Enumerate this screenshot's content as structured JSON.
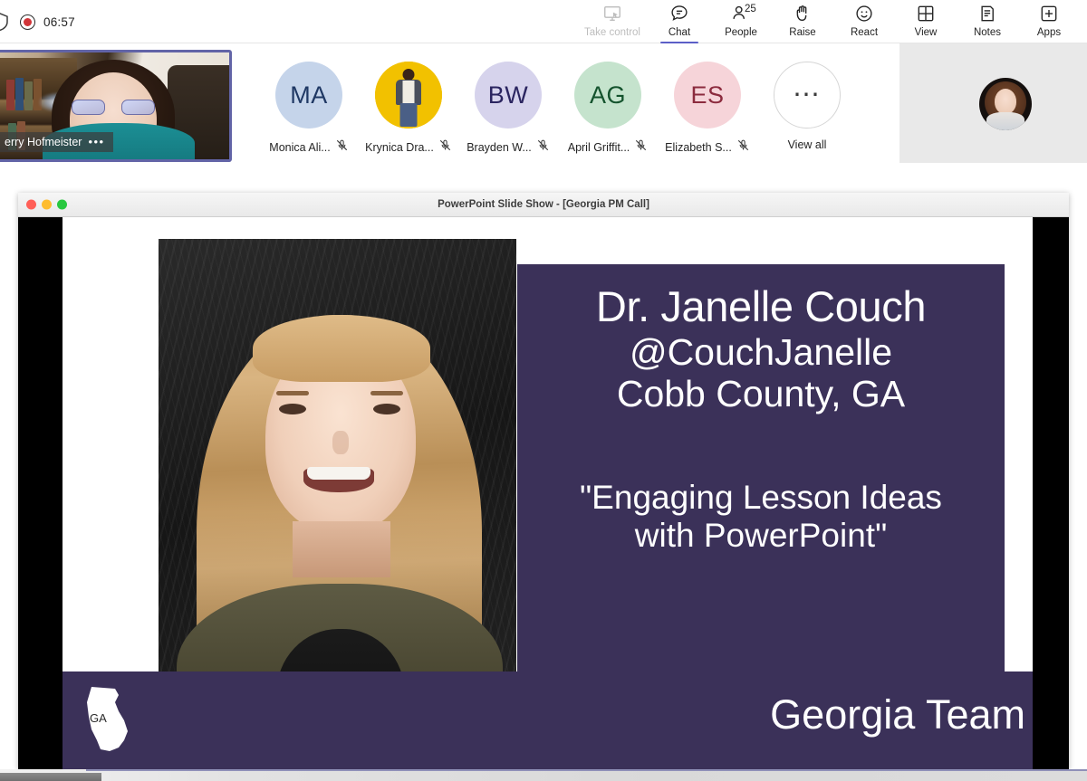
{
  "toolbar": {
    "recording_time": "06:57",
    "shield_icon": "shield-icon",
    "record_icon": "record-dot-icon",
    "items": [
      {
        "label": "Take control",
        "icon": "take-control-icon",
        "disabled": true,
        "active": false,
        "badge": ""
      },
      {
        "label": "Chat",
        "icon": "chat-icon",
        "disabled": false,
        "active": true,
        "badge": ""
      },
      {
        "label": "People",
        "icon": "people-icon",
        "disabled": false,
        "active": false,
        "badge": "25"
      },
      {
        "label": "Raise",
        "icon": "raise-hand-icon",
        "disabled": false,
        "active": false,
        "badge": ""
      },
      {
        "label": "React",
        "icon": "react-smiley-icon",
        "disabled": false,
        "active": false,
        "badge": ""
      },
      {
        "label": "View",
        "icon": "view-grid-icon",
        "disabled": false,
        "active": false,
        "badge": ""
      },
      {
        "label": "Notes",
        "icon": "notes-icon",
        "disabled": false,
        "active": false,
        "badge": ""
      },
      {
        "label": "Apps",
        "icon": "apps-plus-icon",
        "disabled": false,
        "active": false,
        "badge": ""
      }
    ],
    "accent_color": "#5b5fc7"
  },
  "self_tile": {
    "name": "erry Hofmeister",
    "more_dots": "•••",
    "speaking_border_color": "#6264a7"
  },
  "participants": [
    {
      "initials": "MA",
      "name": "Monica Ali...",
      "bg": "#c5d4ea",
      "fg": "#1f3864",
      "muted": true,
      "photo": false
    },
    {
      "initials": "",
      "name": "Krynica Dra...",
      "bg": "#f2c100",
      "fg": "#000000",
      "muted": true,
      "photo": true
    },
    {
      "initials": "BW",
      "name": "Brayden W...",
      "bg": "#d6d3ec",
      "fg": "#2b2560",
      "muted": true,
      "photo": false
    },
    {
      "initials": "AG",
      "name": "April Griffit...",
      "bg": "#c5e3cd",
      "fg": "#14532d",
      "muted": true,
      "photo": false
    },
    {
      "initials": "ES",
      "name": "Elizabeth S...",
      "bg": "#f6d4d9",
      "fg": "#8c2b3e",
      "muted": true,
      "photo": false
    }
  ],
  "view_all": {
    "label": "View all",
    "icon": "overflow-dots-icon"
  },
  "powerpoint": {
    "window_title": "PowerPoint Slide Show - [Georgia PM Call]",
    "traffic_lights": [
      "#ff5f57",
      "#febc2e",
      "#28c840"
    ],
    "slide": {
      "panel_color": "#3b3159",
      "name": "Dr. Janelle Couch",
      "handle": "@CouchJanelle",
      "location": "Cobb County, GA",
      "quote_line1": "\"Engaging Lesson Ideas",
      "quote_line2": "with PowerPoint\"",
      "footer_text": "Georgia Team",
      "state_icon": "georgia-state-icon",
      "state_abbr": "GA",
      "speaker_photo": "speaker-headshot-photo"
    }
  }
}
